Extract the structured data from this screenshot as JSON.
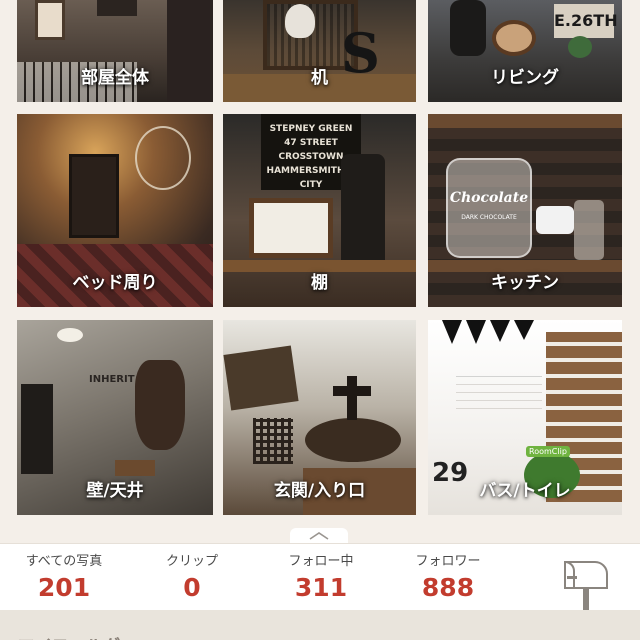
{
  "categories": [
    {
      "label": "部屋全体"
    },
    {
      "label": "机"
    },
    {
      "label": "リビング"
    },
    {
      "label": "ベッド周り"
    },
    {
      "label": "棚"
    },
    {
      "label": "キッチン"
    },
    {
      "label": "壁/天井"
    },
    {
      "label": "玄関/入り口"
    },
    {
      "label": "バス/トイレ"
    }
  ],
  "photo_text": {
    "desk_letter": "S",
    "living_sign": "E.26TH",
    "shelf_sign": [
      "STEPNEY GREEN",
      "47 STREET",
      "CROSSTOWN",
      "HAMMERSMITH & CITY"
    ],
    "kitchen_jar": "Chocolate",
    "kitchen_jar_sub": "DARK CHOCOLATE",
    "wall_sign": "INHERIT",
    "bath_number": "29",
    "bath_tag": "RoomClip"
  },
  "stats": [
    {
      "label": "すべての写真",
      "value": "201"
    },
    {
      "label": "クリップ",
      "value": "0"
    },
    {
      "label": "フォロー中",
      "value": "311"
    },
    {
      "label": "フォロワー",
      "value": "888"
    }
  ],
  "footer": {
    "partial_text": "マイフォルダー"
  },
  "icons": {
    "pull_tab": "chevron-up-icon",
    "mailbox": "mailbox-icon"
  },
  "colors": {
    "accent_red": "#c23c2e",
    "background": "#f4efe9"
  }
}
